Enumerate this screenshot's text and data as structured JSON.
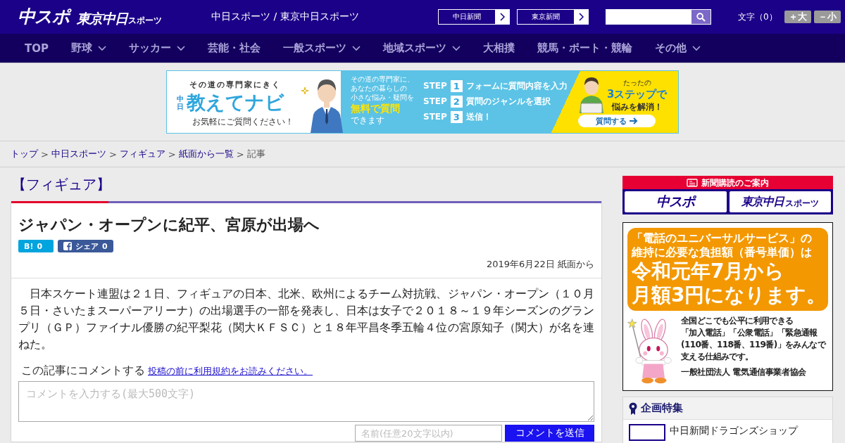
{
  "header": {
    "logos": [
      {
        "text": "中スポ"
      },
      {
        "text": "東京中日",
        "small": "スポーツ"
      }
    ],
    "tagline": "中日スポーツ / 東京中日スポーツ",
    "paper_links": [
      "中日新聞",
      "東京新聞"
    ],
    "font_size": {
      "label": "文字（0）",
      "buttons": [
        "＋大",
        "－小"
      ]
    }
  },
  "nav": [
    {
      "label": "TOP",
      "has_menu": false
    },
    {
      "label": "野球",
      "has_menu": true
    },
    {
      "label": "サッカー",
      "has_menu": true
    },
    {
      "label": "芸能・社会",
      "has_menu": false
    },
    {
      "label": "一般スポーツ",
      "has_menu": true
    },
    {
      "label": "地域スポーツ",
      "has_menu": true
    },
    {
      "label": "大相撲",
      "has_menu": false
    },
    {
      "label": "競馬・ボート・競輪",
      "has_menu": false
    },
    {
      "label": "その他",
      "has_menu": true
    }
  ],
  "banner_ad": {
    "eyebrow": "その道の専門家にきく",
    "brand_mark": "中日",
    "brand": "教えてナビ",
    "note": "お気軽にご質問ください！",
    "intro": [
      "その道の専門家に、",
      "あなたの暮らしの",
      "小さな悩み・疑問を"
    ],
    "highlight": "無料で質問",
    "intro_end": "できます",
    "steps": [
      {
        "label": "STEP",
        "number": "1",
        "text": "フォームに質問内容を入力"
      },
      {
        "label": "STEP",
        "number": "2",
        "text": "質問のジャンルを選択"
      },
      {
        "label": "STEP",
        "number": "3",
        "text": "送信！"
      }
    ],
    "pitch_small": "たったの",
    "pitch_big": "3ステップで",
    "pitch_end": "悩みを解消！",
    "cta": "質問する"
  },
  "breadcrumb": {
    "separator": ">",
    "items": [
      {
        "label": "トップ",
        "current": false
      },
      {
        "label": "中日スポーツ",
        "current": false
      },
      {
        "label": "フィギュア",
        "current": false
      },
      {
        "label": "紙面から一覧",
        "current": false
      },
      {
        "label": "記事",
        "current": true
      }
    ]
  },
  "article": {
    "category": "【フィギュア】",
    "title": "ジャパン・オープンに紀平、宮原が出場へ",
    "share": [
      {
        "kind": "hatena",
        "label": "B!",
        "count": "0"
      },
      {
        "kind": "facebook",
        "label": "シェア",
        "count": "0"
      }
    ],
    "date": "2019年6月22日 紙面から",
    "body": "　日本スケート連盟は２１日、フィギュアの日本、北米、欧州によるチーム対抗戦、ジャパン・オープン（１０月５日・さいたまスーパーアリーナ）の出場選手の一部を発表し、日本は女子で２０１８～１９年シーズンのグランプリ（ＧＰ）ファイナル優勝の紀平梨花（関大ＫＦＳＣ）と１８年平昌冬季五輪４位の宮原知子（関大）が名を連ねた。"
  },
  "comments": {
    "prompt": "この記事にコメントする",
    "terms_link": "投稿の前に利用規約をお読みください。",
    "placeholder": "コメントを入力する(最大500文字)",
    "name_placeholder": "名前(任意20文字以内)",
    "submit": "コメントを送信"
  },
  "sidebar": {
    "subscription": {
      "title": "新聞購読のご案内",
      "logos": [
        {
          "text": "中スポ"
        },
        {
          "text": "東京中日",
          "small": "スポーツ"
        }
      ]
    },
    "notice_ad": {
      "headline": [
        "「電話のユニバーサルサービス」の",
        "維持に必要な負担額（番号単価）は"
      ],
      "announcement": [
        "令和元年7月から",
        "月額3円になります。"
      ],
      "body": [
        "全国どこでも公平に利用できる",
        "「加入電話」「公衆電話」「緊急通報",
        "(110番、118番、119番)」をみんなで",
        "支える仕組みです。"
      ],
      "sponsor": "一般社団法人 電気通信事業者協会"
    },
    "features": {
      "title": "企画特集",
      "items": [
        {
          "label": "中日新聞ドラゴンズショップ"
        }
      ]
    }
  }
}
